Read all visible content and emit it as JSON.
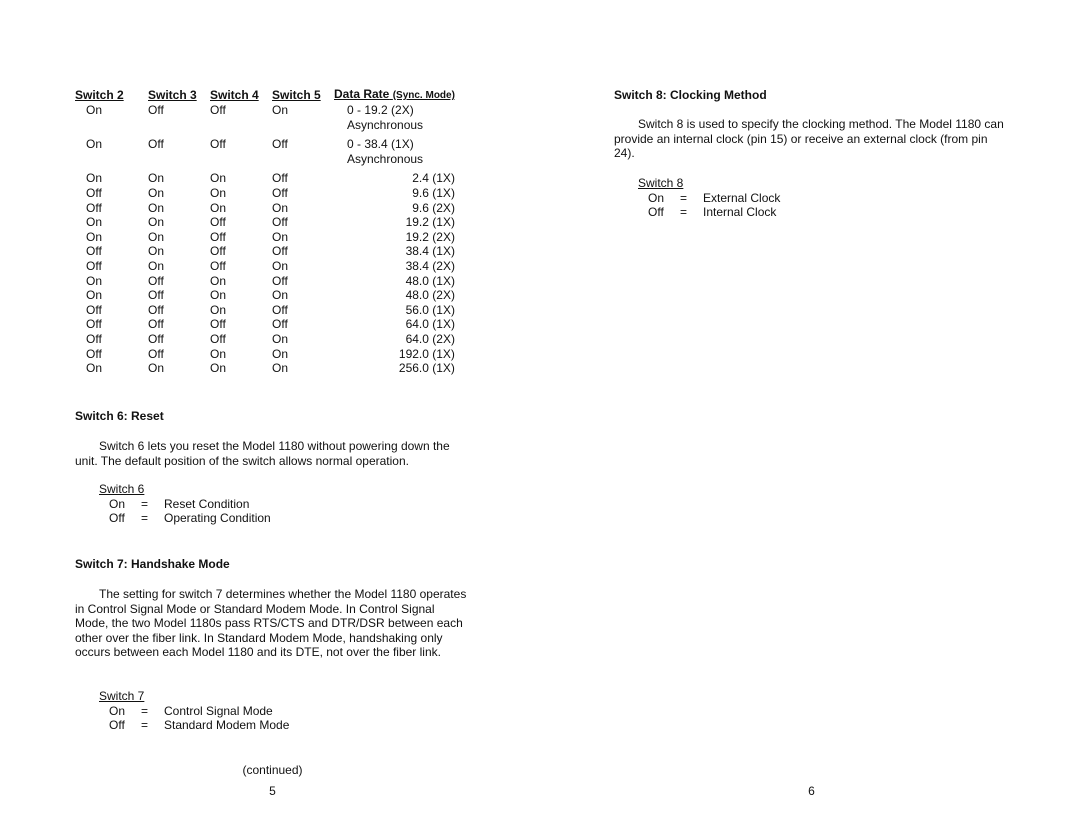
{
  "left_page": {
    "table": {
      "headers": [
        "Switch 2",
        "Switch 3",
        "Switch 4",
        "Switch 5",
        "Data Rate",
        "(Sync. Mode)"
      ],
      "rows": [
        {
          "s2": "On",
          "s3": "Off",
          "s4": "Off",
          "s5": "On",
          "rate": "0 - 19.2 (2X)",
          "note": "Asynchronous"
        },
        {
          "s2": "On",
          "s3": "Off",
          "s4": "Off",
          "s5": "Off",
          "rate": "0 - 38.4 (1X)",
          "note": "Asynchronous"
        },
        {
          "s2": "On",
          "s3": "On",
          "s4": "On",
          "s5": "Off",
          "rate": "2.4 (1X)"
        },
        {
          "s2": "Off",
          "s3": "On",
          "s4": "On",
          "s5": "Off",
          "rate": "9.6 (1X)"
        },
        {
          "s2": "Off",
          "s3": "On",
          "s4": "On",
          "s5": "On",
          "rate": "9.6 (2X)"
        },
        {
          "s2": "On",
          "s3": "On",
          "s4": "Off",
          "s5": "Off",
          "rate": "19.2 (1X)"
        },
        {
          "s2": "On",
          "s3": "On",
          "s4": "Off",
          "s5": "On",
          "rate": "19.2 (2X)"
        },
        {
          "s2": "Off",
          "s3": "On",
          "s4": "Off",
          "s5": "Off",
          "rate": "38.4 (1X)"
        },
        {
          "s2": "Off",
          "s3": "On",
          "s4": "Off",
          "s5": "On",
          "rate": "38.4 (2X)"
        },
        {
          "s2": "On",
          "s3": "Off",
          "s4": "On",
          "s5": "Off",
          "rate": "48.0 (1X)"
        },
        {
          "s2": "On",
          "s3": "Off",
          "s4": "On",
          "s5": "On",
          "rate": "48.0 (2X)"
        },
        {
          "s2": "Off",
          "s3": "Off",
          "s4": "On",
          "s5": "Off",
          "rate": "56.0 (1X)"
        },
        {
          "s2": "Off",
          "s3": "Off",
          "s4": "Off",
          "s5": "Off",
          "rate": "64.0 (1X)"
        },
        {
          "s2": "Off",
          "s3": "Off",
          "s4": "Off",
          "s5": "On",
          "rate": "64.0 (2X)"
        },
        {
          "s2": "Off",
          "s3": "Off",
          "s4": "On",
          "s5": "On",
          "rate": "192.0 (1X)"
        },
        {
          "s2": "On",
          "s3": "On",
          "s4": "On",
          "s5": "On",
          "rate": "256.0 (1X)"
        }
      ]
    },
    "switch6": {
      "heading": "Switch 6:  Reset",
      "paragraph": "Switch 6 lets you reset the Model 1180 without powering down the unit.  The default position of the switch allows normal operation.",
      "legend_title": "Switch 6",
      "legend": [
        {
          "key": "On",
          "eq": "=",
          "value": "Reset Condition"
        },
        {
          "key": "Off",
          "eq": "=",
          "value": "Operating Condition"
        }
      ]
    },
    "switch7": {
      "heading": "Switch 7:  Handshake Mode",
      "paragraph": "The setting for switch 7 determines whether the Model 1180 operates in Control Signal Mode or Standard Modem Mode.  In Control Signal Mode, the two Model 1180s pass RTS/CTS and DTR/DSR between each other over the fiber link.  In Standard Modem Mode, handshaking only occurs between each Model 1180 and its DTE, not over the fiber link.",
      "legend_title": "Switch 7",
      "legend": [
        {
          "key": "On",
          "eq": "=",
          "value": "Control Signal Mode"
        },
        {
          "key": "Off",
          "eq": "=",
          "value": "Standard Modem Mode"
        }
      ]
    },
    "continued": "(continued)",
    "page_number": "5"
  },
  "right_page": {
    "switch8": {
      "heading": "Switch 8:  Clocking Method",
      "paragraph": "Switch 8 is used to specify the clocking method.  The Model 1180 can provide an internal clock (pin 15) or receive an external clock (from pin 24).",
      "legend_title": "Switch 8",
      "legend": [
        {
          "key": "On",
          "eq": "=",
          "value": "External Clock"
        },
        {
          "key": "Off",
          "eq": "=",
          "value": "Internal Clock"
        }
      ]
    },
    "page_number": "6"
  }
}
